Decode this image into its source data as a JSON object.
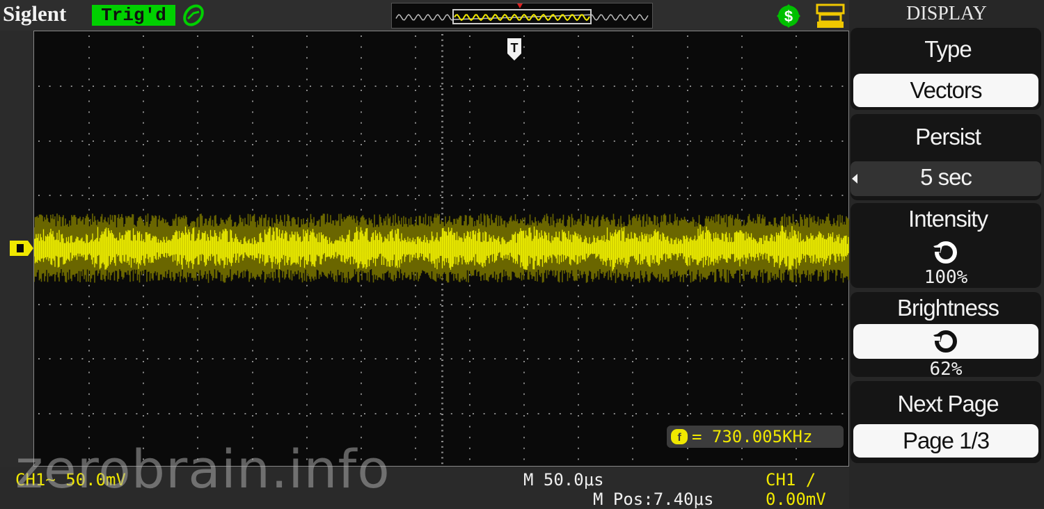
{
  "header": {
    "brand": "Siglent",
    "trigger_status": "Trig'd",
    "icons": [
      "trigger-edge-icon",
      "dollar-icon",
      "usb-printer-icon"
    ]
  },
  "menu": {
    "title": "DISPLAY",
    "type_label": "Type",
    "type_value": "Vectors",
    "persist_label": "Persist",
    "persist_value": "5 sec",
    "intensity_label": "Intensity",
    "intensity_value": "100%",
    "brightness_label": "Brightness",
    "brightness_value": "62%",
    "next_page_label": "Next Page",
    "page_value": "Page 1/3"
  },
  "measure": {
    "frequency": "= 730.005KHz"
  },
  "status": {
    "ch1_scale": "CH1~ 50.0mV",
    "timebase": "M 50.0μs",
    "trigger": "CH1 ∕ 0.00mV",
    "position": "M Pos:7.40μs"
  },
  "watermark": "zerobrain.info",
  "colors": {
    "trace": "#f0f000",
    "trace_dim": "#6a6600",
    "trig_green": "#00d000",
    "background": "#0a0a0a"
  }
}
